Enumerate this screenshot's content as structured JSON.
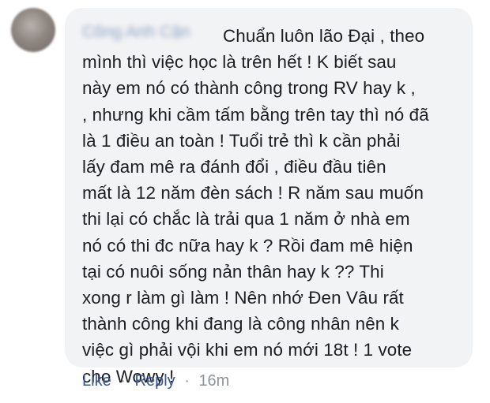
{
  "comment": {
    "author_name": "Công Anh Cận",
    "lines": [
      "Chuẩn luôn lão Đại , theo",
      "mình thì việc học là trên hết ! K biết sau",
      "này em nó có thành công trong RV hay k ,",
      ", nhưng khi cầm tấm bằng trên tay thì nó đã",
      "là 1 điều an toàn ! Tuổi trẻ thì k cần phải",
      "lấy đam mê ra đánh đổi , điều đầu tiên",
      "mất là 12 năm đèn sách ! R năm sau muốn",
      "thi lại có chắc là trải qua 1 năm ở nhà em",
      "nó có thi đc nữa hay k ? Rồi đam mê hiện",
      "tại có nuôi sống nản thân hay k ?? Thi",
      "xong r làm gì làm ! Nên nhớ Đen Vâu rất",
      "thành công khi đang là công nhân nên k",
      "việc gì phải vội khi em nó mới 18t ! 1 vote",
      "cho Wowy !"
    ]
  },
  "actions": {
    "like_label": "Like",
    "separator": "·",
    "reply_label": "Reply",
    "timestamp": "16m"
  },
  "colors": {
    "bubble": "#f2f3f5",
    "text": "#1c1e21",
    "link": "#385898",
    "meta": "#90949c"
  }
}
